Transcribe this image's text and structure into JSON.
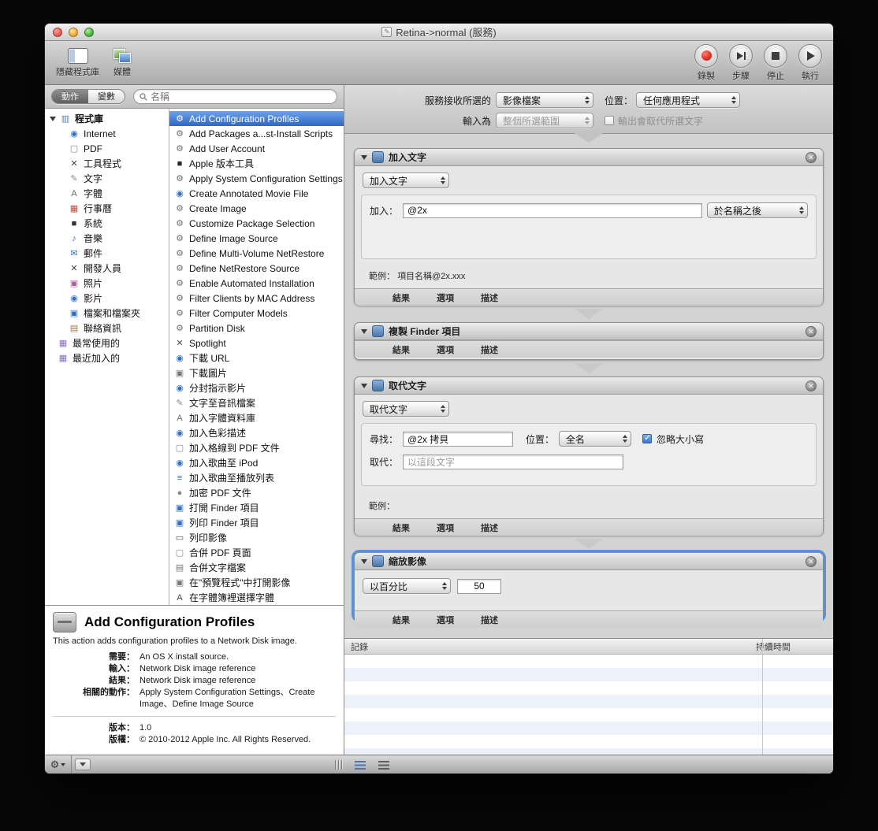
{
  "window": {
    "title": "Retina->normal (服務)"
  },
  "colors": {
    "selection_blue": "#2d66c8",
    "card_selected_border": "#5791d9",
    "record_red": "#d92f22"
  },
  "toolbar": {
    "left": [
      {
        "label": "隱藏程式庫",
        "icon": "library-panel-icon"
      },
      {
        "label": "媒體",
        "icon": "media-icon"
      }
    ],
    "right": [
      {
        "label": "錄製",
        "icon": "record-icon"
      },
      {
        "label": "步驟",
        "icon": "step-icon"
      },
      {
        "label": "停止",
        "icon": "stop-icon"
      },
      {
        "label": "執行",
        "icon": "run-icon"
      }
    ]
  },
  "library": {
    "tabs": [
      "動作",
      "變數"
    ],
    "selected_tab": "動作",
    "search_placeholder": "名稱",
    "root": "程式庫",
    "categories": [
      {
        "label": "Internet",
        "icon": "globe-icon"
      },
      {
        "label": "PDF",
        "icon": "pdf-icon"
      },
      {
        "label": "工具程式",
        "icon": "utilities-icon"
      },
      {
        "label": "文字",
        "icon": "text-icon"
      },
      {
        "label": "字體",
        "icon": "fonts-icon"
      },
      {
        "label": "行事曆",
        "icon": "calendar-icon"
      },
      {
        "label": "系統",
        "icon": "system-icon"
      },
      {
        "label": "音樂",
        "icon": "music-icon"
      },
      {
        "label": "郵件",
        "icon": "mail-icon"
      },
      {
        "label": "開發人員",
        "icon": "developer-icon"
      },
      {
        "label": "照片",
        "icon": "photos-icon"
      },
      {
        "label": "影片",
        "icon": "movies-icon"
      },
      {
        "label": "檔案和檔案夾",
        "icon": "files-icon"
      },
      {
        "label": "聯絡資訊",
        "icon": "contacts-icon"
      }
    ],
    "smart_groups": [
      {
        "label": "最常使用的",
        "icon": "smart-folder-icon"
      },
      {
        "label": "最近加入的",
        "icon": "smart-folder-icon"
      }
    ],
    "selected_action_index": 0,
    "actions": [
      {
        "label": "Add Configuration Profiles",
        "icon": "gear-icon"
      },
      {
        "label": "Add Packages a...st-Install Scripts",
        "icon": "gear-icon"
      },
      {
        "label": "Add User Account",
        "icon": "gear-icon"
      },
      {
        "label": "Apple 版本工具",
        "icon": "app-icon"
      },
      {
        "label": "Apply System Configuration Settings",
        "icon": "gear-icon"
      },
      {
        "label": "Create Annotated Movie File",
        "icon": "quicktime-icon"
      },
      {
        "label": "Create Image",
        "icon": "gear-icon"
      },
      {
        "label": "Customize Package Selection",
        "icon": "gear-icon"
      },
      {
        "label": "Define Image Source",
        "icon": "gear-icon"
      },
      {
        "label": "Define Multi-Volume NetRestore",
        "icon": "gear-icon"
      },
      {
        "label": "Define NetRestore Source",
        "icon": "gear-icon"
      },
      {
        "label": "Enable Automated Installation",
        "icon": "gear-icon"
      },
      {
        "label": "Filter Clients by MAC Address",
        "icon": "gear-icon"
      },
      {
        "label": "Filter Computer Models",
        "icon": "gear-icon"
      },
      {
        "label": "Partition Disk",
        "icon": "gear-icon"
      },
      {
        "label": "Spotlight",
        "icon": "tools-icon"
      },
      {
        "label": "下載 URL",
        "icon": "globe-icon"
      },
      {
        "label": "下載圖片",
        "icon": "image-icon"
      },
      {
        "label": "分封指示影片",
        "icon": "movie-icon"
      },
      {
        "label": "文字至音訊檔案",
        "icon": "text-icon"
      },
      {
        "label": "加入字體資料庫",
        "icon": "font-icon"
      },
      {
        "label": "加入色彩描述",
        "icon": "color-icon"
      },
      {
        "label": "加入格線到 PDF 文件",
        "icon": "pdf-icon"
      },
      {
        "label": "加入歌曲至 iPod",
        "icon": "ipod-icon"
      },
      {
        "label": "加入歌曲至播放列表",
        "icon": "playlist-icon"
      },
      {
        "label": "加密 PDF 文件",
        "icon": "lock-icon"
      },
      {
        "label": "打開 Finder 項目",
        "icon": "finder-icon"
      },
      {
        "label": "列印 Finder 項目",
        "icon": "finder-icon"
      },
      {
        "label": "列印影像",
        "icon": "print-icon"
      },
      {
        "label": "合併 PDF 頁面",
        "icon": "pdf-icon"
      },
      {
        "label": "合併文字檔案",
        "icon": "merge-icon"
      },
      {
        "label": "在\"預覽程式\"中打開影像",
        "icon": "preview-icon"
      },
      {
        "label": "在字體簿裡選擇字體",
        "icon": "fontbook-icon"
      }
    ]
  },
  "description": {
    "title": "Add Configuration Profiles",
    "summary": "This action adds configuration profiles to a Network Disk image.",
    "fields": [
      {
        "label": "需要：",
        "value": "An OS X install source."
      },
      {
        "label": "輸入：",
        "value": "Network Disk image reference"
      },
      {
        "label": "結果：",
        "value": "Network Disk image reference"
      },
      {
        "label": "相關的動作：",
        "value": "Apply System Configuration Settings、Create Image、Define Image Source"
      }
    ],
    "version_label": "版本：",
    "version": "1.0",
    "copyright_label": "版權：",
    "copyright": "© 2010-2012 Apple Inc. All Rights Reserved."
  },
  "service_header": {
    "receives_label": "服務接收所選的",
    "receives_value": "影像檔案",
    "position_label": "位置：",
    "position_value": "任何應用程式",
    "input_label": "輸入為",
    "input_value": "整個所選範圍",
    "output_checkbox_label": "輸出會取代所選文字"
  },
  "workflow": [
    {
      "title": "加入文字",
      "popup": "加入文字",
      "add_label": "加入：",
      "add_value": "@2x",
      "position_popup": "於名稱之後",
      "example_label": "範例：",
      "example": "項目名稱@2x.xxx",
      "footer": [
        "結果",
        "選項",
        "描述"
      ]
    },
    {
      "title": "複製 Finder 項目",
      "footer": [
        "結果",
        "選項",
        "描述"
      ]
    },
    {
      "title": "取代文字",
      "popup": "取代文字",
      "find_label": "尋找：",
      "find_value": "@2x 拷貝",
      "position_label": "位置：",
      "position_value": "全名",
      "ignore_case_label": "忽略大小寫",
      "replace_label": "取代：",
      "replace_placeholder": "以這段文字",
      "example_label": "範例：",
      "footer": [
        "結果",
        "選項",
        "描述"
      ]
    },
    {
      "title": "縮放影像",
      "popup": "以百分比",
      "value": "50",
      "footer": [
        "結果",
        "選項",
        "描述"
      ]
    }
  ],
  "log": {
    "columns": [
      "記錄",
      "持續時間"
    ]
  }
}
